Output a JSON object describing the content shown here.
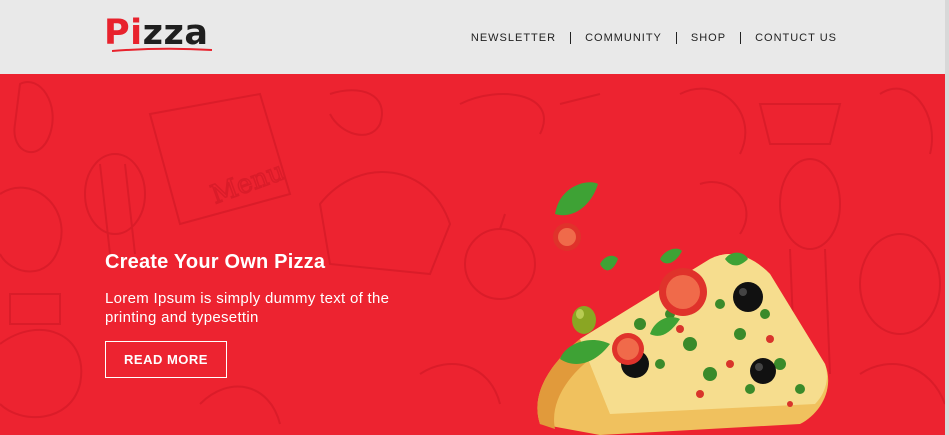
{
  "header": {
    "logo_part1": "Pi",
    "logo_part2": "zza",
    "nav": [
      {
        "label": "NEWSLETTER"
      },
      {
        "label": "COMMUNITY"
      },
      {
        "label": "SHOP"
      },
      {
        "label": "CONTUCT US"
      }
    ]
  },
  "hero": {
    "title": "Create Your Own Pizza",
    "text": "Lorem Ipsum is simply dummy text of the printing and typesettin",
    "button_label": "READ MORE"
  },
  "colors": {
    "brand_red": "#ed2330",
    "header_bg": "#e9e9e9",
    "text_dark": "#222222"
  }
}
